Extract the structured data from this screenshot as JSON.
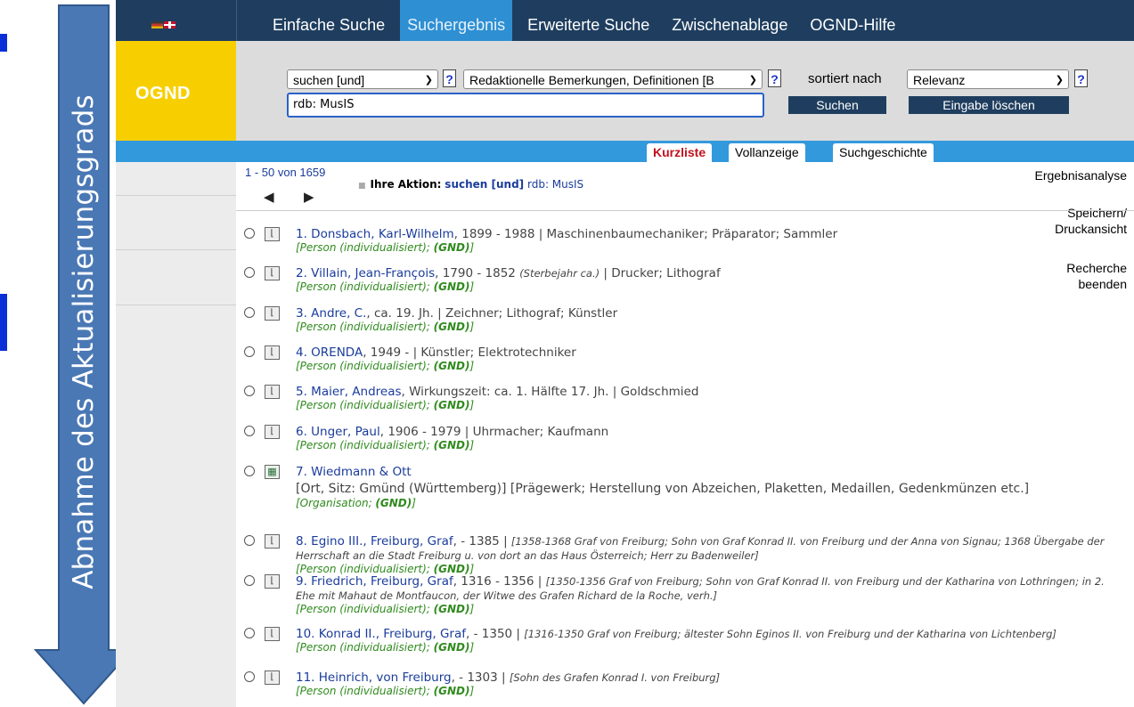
{
  "overlay": {
    "arrow_label": "Abnahme des Aktualisierungsgrads"
  },
  "app": {
    "brand": "OGND",
    "nav": [
      "Einfache Suche",
      "Suchergebnis",
      "Erweiterte Suche",
      "Zwischenablage",
      "OGND-Hilfe"
    ],
    "nav_active": "Suchergebnis",
    "search": {
      "operator": "suchen [und]",
      "field": "Redaktionelle Bemerkungen, Definitionen [B",
      "sort_label": "sortiert nach",
      "sort": "Relevanz",
      "help": "?",
      "query": "rdb: MusIS",
      "submit": "Suchen",
      "clear": "Eingabe löschen"
    },
    "tabs": [
      "Kurzliste",
      "Vollanzeige",
      "Suchgeschichte"
    ],
    "sidebar": {
      "analysis": "Ergebnisanalyse",
      "save_1": "Speichern/",
      "save_2": "Druckansicht",
      "end_1": "Recherche",
      "end_2": "beenden"
    },
    "result_count": "1 - 50 von 1659",
    "pager_prev": "◀",
    "pager_next": "▶",
    "action": {
      "label": "Ihre Aktion:",
      "op": "suchen [und]",
      "query": "rdb: MusIS"
    },
    "results": [
      {
        "num": "1.",
        "name": "Donsbach, Karl-Wilhelm",
        "details": ", 1899 - 1988 | Maschinenbaumechaniker; Präparator; Sammler",
        "note": "",
        "note2": "",
        "type": "Person (individualisiert)",
        "icon": "person-record-icon"
      },
      {
        "num": "2.",
        "name": "Villain, Jean-François",
        "details": ", 1790 - 1852 ",
        "italic_mid": "(Sterbejahr ca.)",
        "details2": " | Drucker; Lithograf",
        "type": "Person (individualisiert)",
        "icon": "person-record-icon"
      },
      {
        "num": "3.",
        "name": "Andre, C.",
        "details": ", ca. 19. Jh. | Zeichner; Lithograf; Künstler",
        "type": "Person (individualisiert)",
        "icon": "person-record-icon"
      },
      {
        "num": "4.",
        "name": "ORENDA",
        "details": ", 1949 - | Künstler; Elektrotechniker",
        "type": "Person (individualisiert)",
        "icon": "person-record-icon"
      },
      {
        "num": "5.",
        "name": "Maier, Andreas",
        "details": ", Wirkungszeit: ca. 1. Hälfte 17. Jh. | Goldschmied",
        "type": "Person (individualisiert)",
        "icon": "person-record-icon"
      },
      {
        "num": "6.",
        "name": "Unger, Paul",
        "details": ", 1906 - 1979 | Uhrmacher; Kaufmann",
        "type": "Person (individualisiert)",
        "icon": "person-record-icon"
      },
      {
        "num": "7.",
        "name": "Wiedmann & Ott",
        "details": "",
        "extra": "[Ort, Sitz: Gmünd (Württemberg)] [Prägewerk; Herstellung von Abzeichen, Plaketten, Medaillen, Gedenkmünzen etc.]",
        "type": "Organisation",
        "icon": "organisation-record-icon"
      },
      {
        "num": "8.",
        "name": "Egino III., Freiburg, Graf",
        "details": ", - 1385 | ",
        "note": "[1358-1368 Graf von Freiburg; Sohn von Graf Konrad II. von Freiburg und der Anna von Signau; 1368 Übergabe der Herrschaft an die Stadt Freiburg u. von dort an das Haus Österreich; Herr zu Badenweiler]",
        "type": "Person (individualisiert)",
        "icon": "person-record-icon"
      },
      {
        "num": "9.",
        "name": "Friedrich, Freiburg, Graf",
        "details": ", 1316 - 1356 | ",
        "note": "[1350-1356 Graf von Freiburg; Sohn von Graf Konrad II. von Freiburg und der Katharina von Lothringen; in 2. Ehe mit Mahaut de Montfaucon, der Witwe des Grafen Richard de la Roche, verh.]",
        "type": "Person (individualisiert)",
        "icon": "person-record-icon"
      },
      {
        "num": "10.",
        "name": "Konrad II., Freiburg, Graf",
        "details": ", - 1350 | ",
        "note": "[1316-1350 Graf von Freiburg; ältester Sohn Eginos II. von Freiburg und der Katharina von Lichtenberg]",
        "type": "Person (individualisiert)",
        "icon": "person-record-icon"
      },
      {
        "num": "11.",
        "name": "Heinrich, von Freiburg",
        "details": ", - 1303 | ",
        "note": "[Sohn des Grafen Konrad I. von Freiburg]",
        "type": "Person (individualisiert)",
        "icon": "person-record-icon"
      }
    ],
    "gnd_label": "(GND)",
    "colors": {
      "nav_bg": "#1f3e5f",
      "nav_active": "#2e8fd3",
      "brand": "#f7cf00",
      "tab_strip": "#3399dd",
      "link": "#1a3c9c",
      "gnd": "#2f8a1d"
    }
  }
}
